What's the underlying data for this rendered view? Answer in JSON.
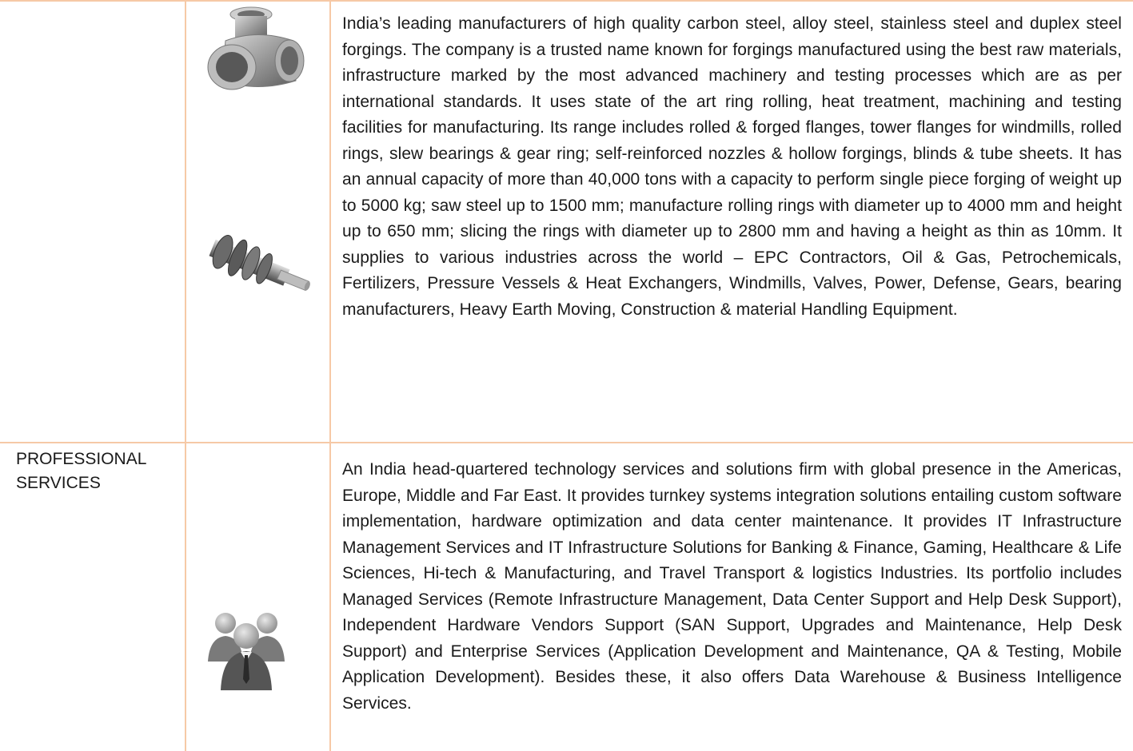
{
  "rows": [
    {
      "sector": "",
      "images": [
        "pipe-fitting-icon",
        "forged-shaft-icon"
      ],
      "description": "India’s leading manufacturers of high quality carbon steel, alloy steel, stainless steel and duplex steel forgings. The company is a trusted name known for forgings manufactured using the best raw materials, infrastructure marked by the most advanced machinery and testing processes which are as per international standards. It uses state of the art ring rolling, heat treatment, machining and testing facilities for manufacturing. Its range includes rolled & forged flanges, tower flanges for windmills, rolled rings, slew bearings & gear ring; self-reinforced nozzles & hollow forgings, blinds & tube sheets. It has an annual capacity of more than 40,000 tons with a capacity to perform single piece forging of weight up to 5000 kg; saw steel up to 1500 mm; manufacture rolling rings with diameter up to 4000 mm and height up to 650 mm; slicing the rings with diameter up to 2800 mm and having a height as thin as 10mm. It supplies to various industries across the world – EPC Contractors, Oil & Gas, Petrochemicals, Fertilizers, Pressure Vessels & Heat Exchangers, Windmills, Valves, Power, Defense, Gears, bearing manufacturers, Heavy Earth Moving, Construction & material Handling Equipment."
    },
    {
      "sector": "PROFESSIONAL SERVICES",
      "images": [
        "business-people-icon"
      ],
      "description": "An India head-quartered technology services and solutions firm with global presence in the Americas, Europe, Middle and Far East. It provides turnkey systems integration solutions entailing custom software implementation, hardware optimization and data center maintenance. It provides IT Infrastructure Management Services and IT Infrastructure Solutions for Banking & Finance, Gaming, Healthcare & Life Sciences, Hi-tech & Manufacturing, and Travel Transport & logistics Industries. Its portfolio includes Managed Services (Remote Infrastructure Management, Data Center Support and Help Desk Support), Independent Hardware Vendors Support (SAN Support, Upgrades and Maintenance, Help Desk Support) and Enterprise Services (Application Development and Maintenance, QA & Testing, Mobile Application Development). Besides these, it also offers Data Warehouse & Business Intelligence Services."
    }
  ],
  "colors": {
    "border": "#f6c9a6",
    "text": "#1a1a1a"
  }
}
